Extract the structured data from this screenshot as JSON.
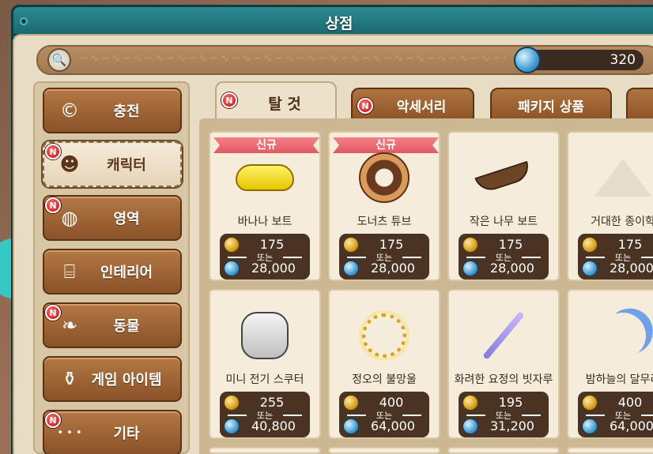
{
  "window": {
    "title": "상점"
  },
  "currency": {
    "gems": "320"
  },
  "sidebar": {
    "items": [
      {
        "label": "충전",
        "icon": "copyright-coin-icon",
        "badge": ""
      },
      {
        "label": "캐릭터",
        "icon": "character-icon",
        "badge": "N"
      },
      {
        "label": "영역",
        "icon": "cow-pattern-icon",
        "badge": "N"
      },
      {
        "label": "인테리어",
        "icon": "chair-icon",
        "badge": ""
      },
      {
        "label": "동물",
        "icon": "rabbit-icon",
        "badge": "N"
      },
      {
        "label": "게임 아이템",
        "icon": "potion-icon",
        "badge": ""
      },
      {
        "label": "기타",
        "icon": "dots-icon",
        "badge": "N"
      }
    ]
  },
  "tabs": [
    {
      "label": "탈 것",
      "badge": "N",
      "active": true
    },
    {
      "label": "악세서리",
      "badge": "N",
      "active": false
    },
    {
      "label": "패키지 상품",
      "badge": "",
      "active": false
    },
    {
      "label": "",
      "badge": "",
      "active": false
    }
  ],
  "labels": {
    "or": "또는",
    "new": "신규",
    "badge_n": "N"
  },
  "products": [
    {
      "name": "바나나 보트",
      "gold": "175",
      "gems": "28,000",
      "is_new": true,
      "icon": "banana-boat-icon"
    },
    {
      "name": "도너츠 튜브",
      "gold": "175",
      "gems": "28,000",
      "is_new": true,
      "icon": "donut-tube-icon"
    },
    {
      "name": "작은 나무 보트",
      "gold": "175",
      "gems": "28,000",
      "is_new": false,
      "icon": "wooden-boat-icon"
    },
    {
      "name": "거대한 종이학",
      "gold": "175",
      "gems": "28,000",
      "is_new": false,
      "icon": "paper-crane-icon"
    },
    {
      "name": "미니 전기 스쿠터",
      "gold": "255",
      "gems": "40,800",
      "is_new": false,
      "icon": "scooter-icon"
    },
    {
      "name": "정오의 불망울",
      "gold": "400",
      "gems": "64,000",
      "is_new": false,
      "icon": "sun-ring-icon"
    },
    {
      "name": "화려한 요정의 빗자루",
      "gold": "195",
      "gems": "31,200",
      "is_new": false,
      "icon": "fairy-broom-icon"
    },
    {
      "name": "밤하늘의 달무리",
      "gold": "400",
      "gems": "64,000",
      "is_new": false,
      "icon": "crescent-moon-icon"
    }
  ]
}
